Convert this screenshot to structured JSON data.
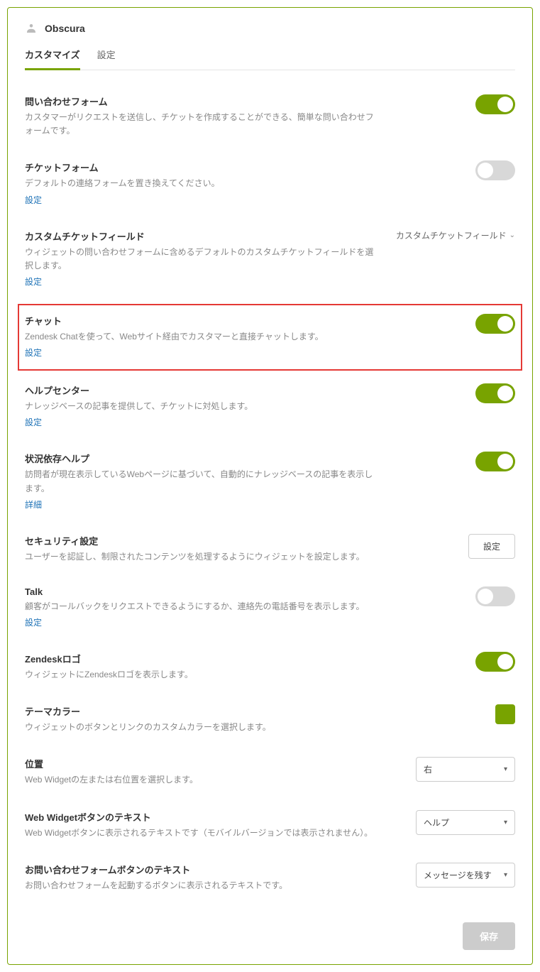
{
  "brand": {
    "name": "Obscura"
  },
  "tabs": {
    "customize": "カスタマイズ",
    "settings": "設定"
  },
  "sections": {
    "contactForm": {
      "title": "問い合わせフォーム",
      "desc": "カスタマーがリクエストを送信し、チケットを作成することができる、簡単な問い合わせフォームです。",
      "toggle": true
    },
    "ticketForm": {
      "title": "チケットフォーム",
      "desc": "デフォルトの連絡フォームを置き換えてください。",
      "link": "設定",
      "toggle": false
    },
    "customFields": {
      "title": "カスタムチケットフィールド",
      "desc": "ウィジェットの問い合わせフォームに含めるデフォルトのカスタムチケットフィールドを選択します。",
      "link": "設定",
      "dropdown": "カスタムチケットフィールド"
    },
    "chat": {
      "title": "チャット",
      "desc": "Zendesk Chatを使って、Webサイト経由でカスタマーと直接チャットします。",
      "link": "設定",
      "toggle": true
    },
    "helpCenter": {
      "title": "ヘルプセンター",
      "desc": "ナレッジベースの記事を提供して、チケットに対処します。",
      "link": "設定",
      "toggle": true
    },
    "contextualHelp": {
      "title": "状況依存ヘルプ",
      "desc": "訪問者が現在表示しているWebページに基づいて、自動的にナレッジベースの記事を表示します。",
      "link": "詳細",
      "toggle": true
    },
    "security": {
      "title": "セキュリティ設定",
      "desc": "ユーザーを認証し、制限されたコンテンツを処理するようにウィジェットを設定します。",
      "button": "設定"
    },
    "talk": {
      "title": "Talk",
      "desc": "顧客がコールバックをリクエストできるようにするか、連絡先の電話番号を表示します。",
      "link": "設定",
      "toggle": false
    },
    "zendeskLogo": {
      "title": "Zendeskロゴ",
      "desc": "ウィジェットにZendeskロゴを表示します。",
      "toggle": true
    },
    "themeColor": {
      "title": "テーマカラー",
      "desc": "ウィジェットのボタンとリンクのカスタムカラーを選択します。",
      "color": "#78a300"
    },
    "position": {
      "title": "位置",
      "desc": "Web Widgetの左または右位置を選択します。",
      "value": "右"
    },
    "buttonText": {
      "title": "Web Widgetボタンのテキスト",
      "desc": "Web Widgetボタンに表示されるテキストです（モバイルバージョンでは表示されません）。",
      "value": "ヘルプ"
    },
    "contactButtonText": {
      "title": "お問い合わせフォームボタンのテキスト",
      "desc": "お問い合わせフォームを起動するボタンに表示されるテキストです。",
      "value": "メッセージを残す"
    }
  },
  "footer": {
    "save": "保存"
  }
}
